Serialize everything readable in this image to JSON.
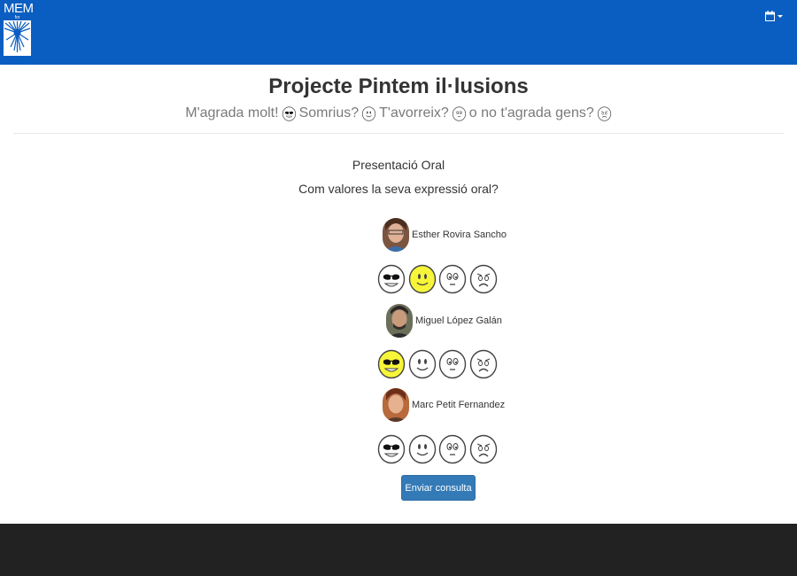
{
  "navbar": {
    "logo_text": "MEM",
    "logo_subtext": "for",
    "calendar_icon": "calendar-icon",
    "color": "#0b5ec1"
  },
  "header": {
    "title": "Projecte Pintem il·lusions",
    "subtitle_parts": [
      "M'agrada molt!",
      "Somrius?",
      "T'avorreix?",
      "o no t'agrada gens?"
    ],
    "subtitle_icons": [
      "cool-face-icon",
      "smile-face-icon",
      "neutral-face-icon",
      "sad-face-icon"
    ]
  },
  "survey": {
    "section_title": "Presentació Oral",
    "question": "Com valores la seva expressió oral?",
    "rating_options": [
      "cool-face-icon",
      "smile-face-icon",
      "neutral-face-icon",
      "sad-face-icon"
    ],
    "highlight_color": "#f7f53a",
    "people": [
      {
        "name": "Esther Rovira Sancho",
        "selected_rating": 2
      },
      {
        "name": "Miguel López Galán",
        "selected_rating": 1
      },
      {
        "name": "Marc Petit Fernandez",
        "selected_rating": null
      }
    ],
    "submit_label": "Enviar consulta"
  }
}
